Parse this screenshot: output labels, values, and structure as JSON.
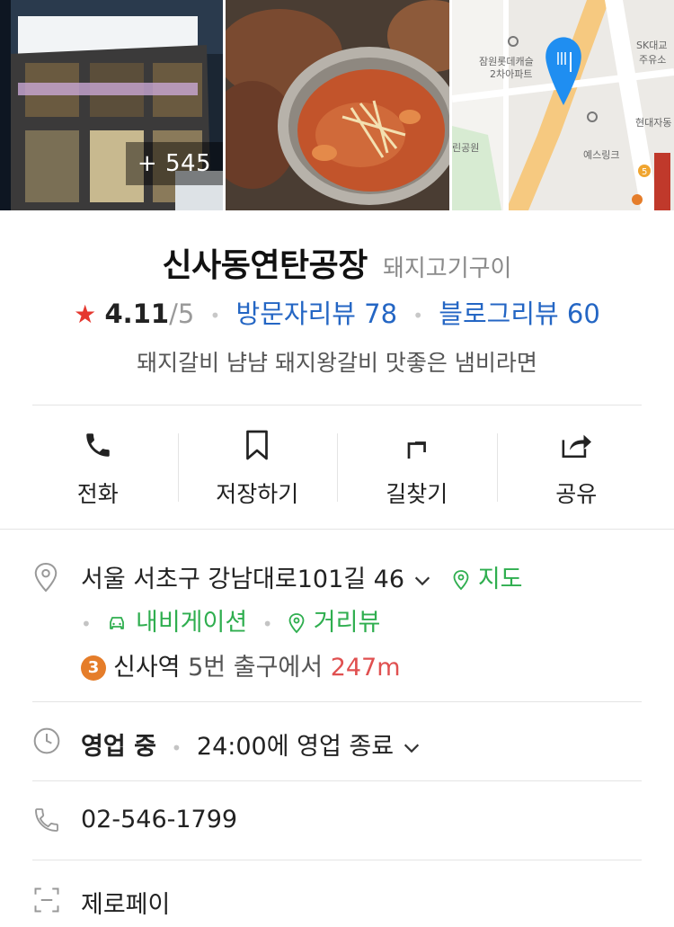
{
  "photos": {
    "more_count": "+ 545"
  },
  "map": {
    "labels": [
      "잠원롯데캐슬",
      "2차아파트",
      "SK대교",
      "주유소",
      "현대자동",
      "예스링크",
      "린공원",
      "5"
    ]
  },
  "place": {
    "name": "신사동연탄공장",
    "category": "돼지고기구이",
    "rating": "4.11",
    "rating_max": "/5",
    "visit_review": "방문자리뷰 78",
    "blog_review": "블로그리뷰 60",
    "description": "돼지갈비 냠냠 돼지왕갈비 맛좋은 냄비라면"
  },
  "actions": [
    {
      "label": "전화",
      "icon": "phone-icon"
    },
    {
      "label": "저장하기",
      "icon": "bookmark-icon"
    },
    {
      "label": "길찾기",
      "icon": "directions-icon"
    },
    {
      "label": "공유",
      "icon": "share-icon"
    }
  ],
  "address": {
    "text": "서울 서초구 강남대로101길 46",
    "map_link": "지도",
    "navigation_link": "내비게이션",
    "streetview_link": "거리뷰"
  },
  "subway": {
    "line": "3",
    "station": "신사역",
    "exit_text": "5번 출구에서",
    "distance": "247m",
    "line_color": "#e57d2a"
  },
  "hours": {
    "status": "영업 중",
    "detail": "24:00에 영업 종료"
  },
  "phone": "02-546-1799",
  "payment": "제로페이",
  "colors": {
    "accent_green": "#2fae4f",
    "link_blue": "#2466c4",
    "star_red": "#e5382f",
    "distance_red": "#e05050"
  }
}
